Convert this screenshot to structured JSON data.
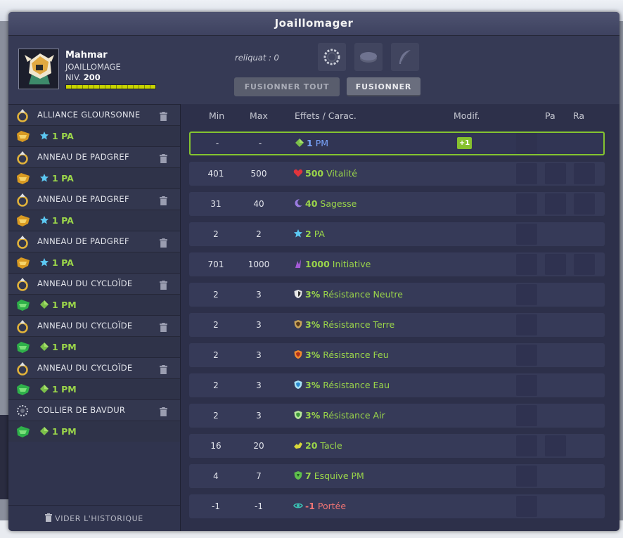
{
  "window": {
    "title": "Joaillomager"
  },
  "player": {
    "name": "Mahmar",
    "job": "JOAILLOMAGE",
    "level_label": "NIV.",
    "level": "200",
    "xp_fraction": 1.0
  },
  "reliquat": "reliquat : 0",
  "buttons": {
    "merge_all": "FUSIONNER TOUT",
    "merge": "FUSIONNER"
  },
  "history": {
    "clear_label": "VIDER L'HISTORIQUE",
    "entries": [
      {
        "item": "ALLIANCE GLOURSONNE",
        "item_icon": "ring-item-icon",
        "rune_value": "1",
        "rune_stat": "PA",
        "rune_icon": "star-icon"
      },
      {
        "item": "ANNEAU DE PADGREF",
        "item_icon": "ring-item-icon",
        "rune_value": "1",
        "rune_stat": "PA",
        "rune_icon": "star-icon"
      },
      {
        "item": "ANNEAU DE PADGREF",
        "item_icon": "ring-item-icon",
        "rune_value": "1",
        "rune_stat": "PA",
        "rune_icon": "star-icon"
      },
      {
        "item": "ANNEAU DE PADGREF",
        "item_icon": "ring-item-icon",
        "rune_value": "1",
        "rune_stat": "PA",
        "rune_icon": "star-icon"
      },
      {
        "item": "ANNEAU DU CYCLOÏDE",
        "item_icon": "ring-item-icon",
        "rune_value": "1",
        "rune_stat": "PM",
        "rune_icon": "diamond-icon"
      },
      {
        "item": "ANNEAU DU CYCLOÏDE",
        "item_icon": "ring-item-icon",
        "rune_value": "1",
        "rune_stat": "PM",
        "rune_icon": "diamond-icon"
      },
      {
        "item": "ANNEAU DU CYCLOÏDE",
        "item_icon": "ring-item-icon",
        "rune_value": "1",
        "rune_stat": "PM",
        "rune_icon": "diamond-icon"
      },
      {
        "item": "COLLIER DE BAVDUR",
        "item_icon": "amulet-item-icon",
        "rune_value": "1",
        "rune_stat": "PM",
        "rune_icon": "diamond-icon"
      }
    ]
  },
  "table": {
    "headers": {
      "min": "Min",
      "max": "Max",
      "effects": "Effets / Carac.",
      "modif": "Modif.",
      "pa": "Pa",
      "ra": "Ra"
    },
    "rows": [
      {
        "min": "-",
        "max": "-",
        "value": "1",
        "stat": "PM",
        "icon": "diamond-icon",
        "color": "#7aa6ff",
        "modif": "+1",
        "selected": true,
        "slots": 1
      },
      {
        "min": "401",
        "max": "500",
        "value": "500",
        "stat": "Vitalité",
        "icon": "heart-icon",
        "color": "#9bd64a",
        "slots": 3
      },
      {
        "min": "31",
        "max": "40",
        "value": "40",
        "stat": "Sagesse",
        "icon": "moon-icon",
        "color": "#9bd64a",
        "slots": 3
      },
      {
        "min": "2",
        "max": "2",
        "value": "2",
        "stat": "PA",
        "icon": "star-icon",
        "color": "#9bd64a",
        "slots": 1
      },
      {
        "min": "701",
        "max": "1000",
        "value": "1000",
        "stat": "Initiative",
        "icon": "initiative-icon",
        "color": "#9bd64a",
        "slots": 3
      },
      {
        "min": "2",
        "max": "3",
        "value": "3%",
        "stat": "Résistance Neutre",
        "icon": "shield-neutral-icon",
        "color": "#9bd64a",
        "slots": 1
      },
      {
        "min": "2",
        "max": "3",
        "value": "3%",
        "stat": "Résistance Terre",
        "icon": "shield-earth-icon",
        "color": "#9bd64a",
        "slots": 1
      },
      {
        "min": "2",
        "max": "3",
        "value": "3%",
        "stat": "Résistance Feu",
        "icon": "shield-fire-icon",
        "color": "#9bd64a",
        "slots": 1
      },
      {
        "min": "2",
        "max": "3",
        "value": "3%",
        "stat": "Résistance Eau",
        "icon": "shield-water-icon",
        "color": "#9bd64a",
        "slots": 1
      },
      {
        "min": "2",
        "max": "3",
        "value": "3%",
        "stat": "Résistance Air",
        "icon": "shield-air-icon",
        "color": "#9bd64a",
        "slots": 1
      },
      {
        "min": "16",
        "max": "20",
        "value": "20",
        "stat": "Tacle",
        "icon": "tackle-icon",
        "color": "#9bd64a",
        "slots": 2
      },
      {
        "min": "4",
        "max": "7",
        "value": "7",
        "stat": "Esquive PM",
        "icon": "dodge-icon",
        "color": "#9bd64a",
        "slots": 1
      },
      {
        "min": "-1",
        "max": "-1",
        "value": "-1",
        "stat": "Portée",
        "icon": "eye-icon",
        "color": "#f07474",
        "slots": 1
      }
    ]
  }
}
